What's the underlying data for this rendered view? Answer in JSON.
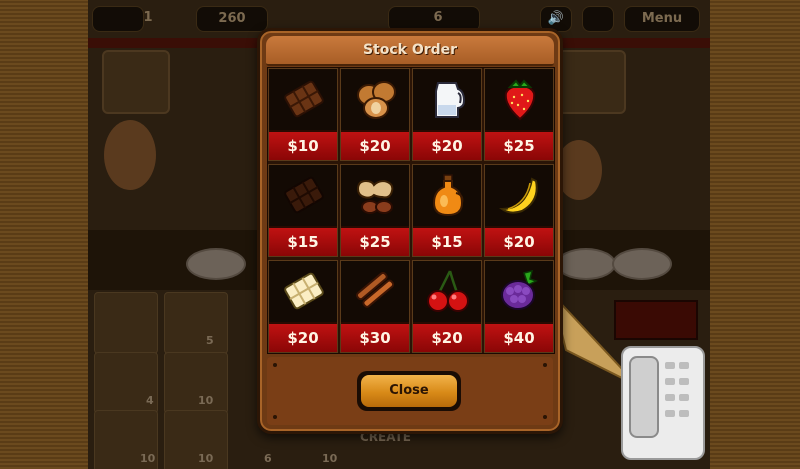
{
  "hud": {
    "day": "1",
    "money": "260",
    "count": "6",
    "menu_label": "Menu"
  },
  "dialog": {
    "title": "Stock Order",
    "close_label": "Close"
  },
  "items": [
    {
      "name": "milk chocolate bar",
      "icon": "chocolate-bar-icon",
      "price": "$10"
    },
    {
      "name": "hazelnuts",
      "icon": "hazelnut-icon",
      "price": "$20"
    },
    {
      "name": "milk",
      "icon": "milk-jug-icon",
      "price": "$20"
    },
    {
      "name": "strawberry",
      "icon": "strawberry-icon",
      "price": "$25"
    },
    {
      "name": "dark chocolate bar",
      "icon": "dark-chocolate-icon",
      "price": "$15"
    },
    {
      "name": "peanuts",
      "icon": "peanut-icon",
      "price": "$25"
    },
    {
      "name": "syrup",
      "icon": "syrup-bottle-icon",
      "price": "$15"
    },
    {
      "name": "banana",
      "icon": "banana-icon",
      "price": "$20"
    },
    {
      "name": "white chocolate bar",
      "icon": "white-chocolate-icon",
      "price": "$20"
    },
    {
      "name": "cinnamon sticks",
      "icon": "cinnamon-icon",
      "price": "$30"
    },
    {
      "name": "cherries",
      "icon": "cherry-icon",
      "price": "$20"
    },
    {
      "name": "blackberry",
      "icon": "blackberry-icon",
      "price": "$40"
    }
  ],
  "inventory_counts": [
    "5",
    "4",
    "10",
    "10",
    "10",
    "6",
    "10"
  ],
  "create_label": "CREATE",
  "colors": {
    "dialog_bg": "#6e3a14",
    "price_red": "#c01212",
    "button_gold": "#f2b34a"
  }
}
